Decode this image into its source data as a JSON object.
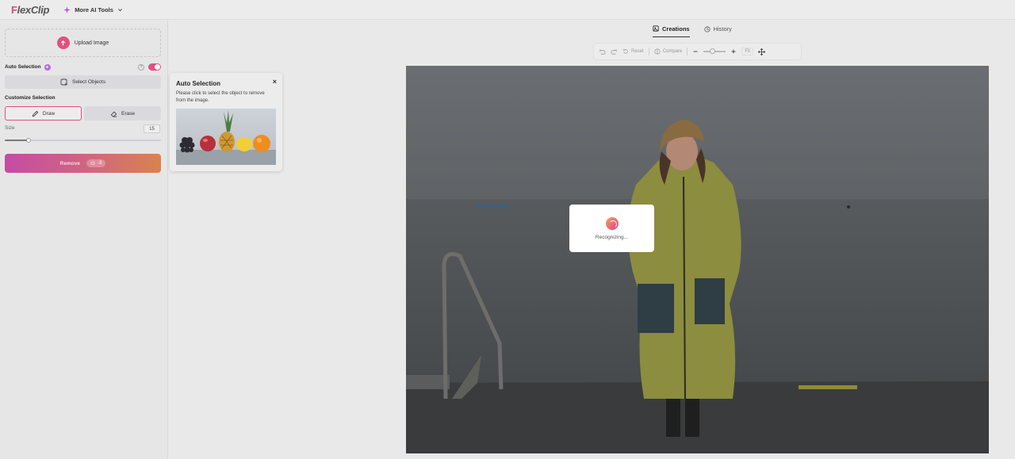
{
  "header": {
    "logo_f": "F",
    "logo_rest": "lexClip",
    "more_tools": "More AI Tools"
  },
  "left_panel": {
    "upload_label": "Upload Image",
    "auto_selection_label": "Auto Selection",
    "auto_selection_enabled": true,
    "select_objects_label": "Select Objects",
    "customize_label": "Customize Selection",
    "draw_label": "Draw",
    "erase_label": "Erase",
    "size_label": "Size",
    "size_value": "15",
    "size_fraction": 0.15,
    "remove_label": "Remove",
    "remove_credits": "-3"
  },
  "popover": {
    "title": "Auto Selection",
    "close_glyph": "×",
    "description": "Please click to select the object to remove from the image."
  },
  "main": {
    "tabs": [
      {
        "label": "Creations",
        "active": true
      },
      {
        "label": "History",
        "active": false
      }
    ],
    "toolbar": {
      "reset_label": "Reset",
      "compare_label": "Compare",
      "fit_label": "Fit"
    },
    "loader_text": "Recognizing..."
  },
  "colors": {
    "accent": "#e0517f",
    "remove_gradient_start": "#c64ba6",
    "remove_gradient_end": "#d8844c"
  }
}
